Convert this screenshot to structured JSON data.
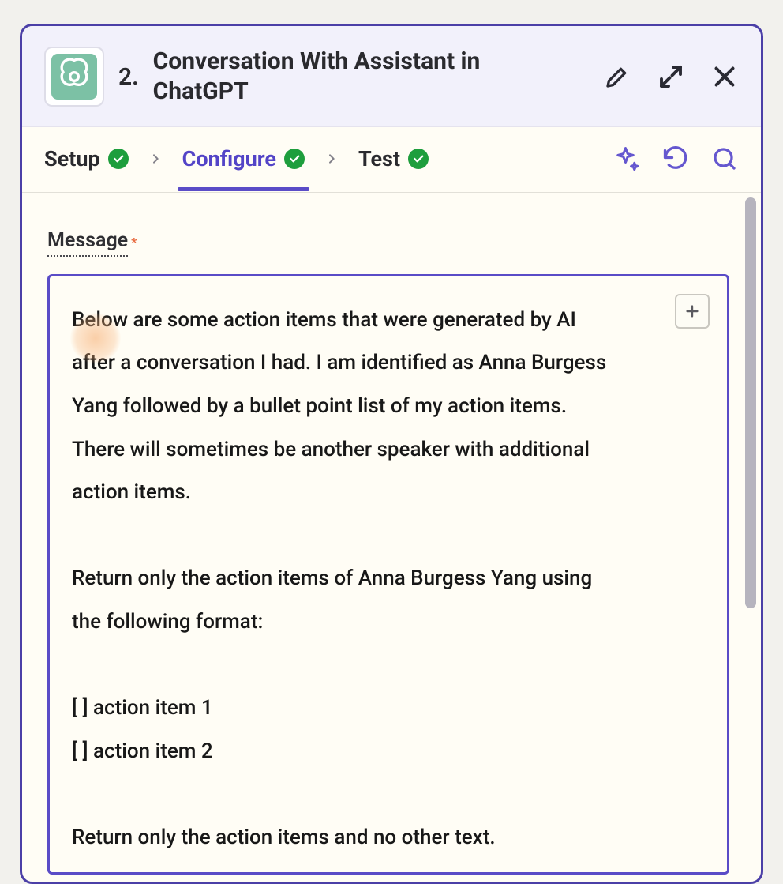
{
  "header": {
    "step_number": "2.",
    "title": "Conversation With Assistant in ChatGPT"
  },
  "tabs": {
    "setup": "Setup",
    "configure": "Configure",
    "test": "Test"
  },
  "field": {
    "label": "Message",
    "required_marker": "*"
  },
  "message": {
    "text": "Below are some action items that were generated by AI after a conversation I had. I am identified as Anna Burgess Yang followed by a bullet point list of my action items. There will sometimes be another speaker with additional action items.\n\nReturn only the action items of Anna Burgess Yang using the following format:\n\n[ ] action item 1\n[ ] action item 2\n\nReturn only the action items and no other text."
  }
}
